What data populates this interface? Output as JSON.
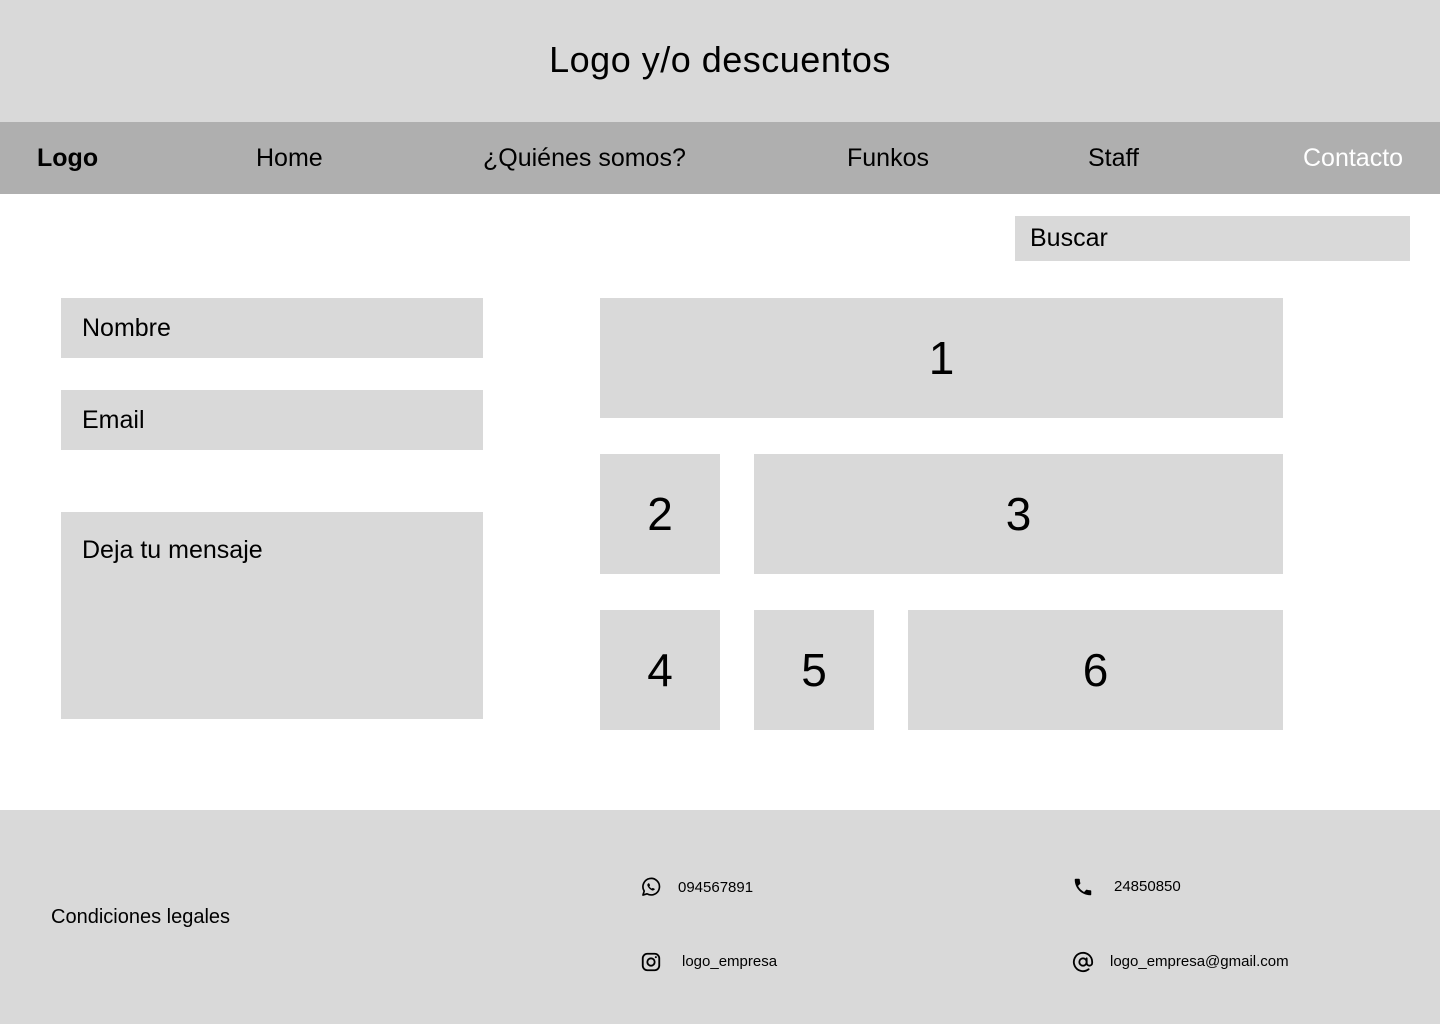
{
  "banner": {
    "title": "Logo y/o descuentos"
  },
  "nav": {
    "logo": "Logo",
    "items": [
      {
        "label": "Home"
      },
      {
        "label": "¿Quiénes somos?"
      },
      {
        "label": "Funkos"
      },
      {
        "label": "Staff"
      },
      {
        "label": "Contacto",
        "active": true
      }
    ]
  },
  "search": {
    "placeholder": "Buscar"
  },
  "form": {
    "name_placeholder": "Nombre",
    "email_placeholder": "Email",
    "message_placeholder": "Deja tu mensaje"
  },
  "tiles": [
    "1",
    "2",
    "3",
    "4",
    "5",
    "6"
  ],
  "footer": {
    "legal": "Condiciones legales",
    "whatsapp": {
      "icon": "whatsapp-icon",
      "value": "094567891"
    },
    "phone": {
      "icon": "phone-icon",
      "value": "24850850"
    },
    "instagram": {
      "icon": "instagram-icon",
      "value": "logo_empresa"
    },
    "email": {
      "icon": "at-sign-icon",
      "value": "logo_empresa@gmail.com"
    }
  },
  "colors": {
    "banner_bg": "#d9d9d9",
    "nav_bg": "#afafaf",
    "placeholder_bg": "#d9d9d9",
    "active_nav_text": "#ffffff"
  }
}
